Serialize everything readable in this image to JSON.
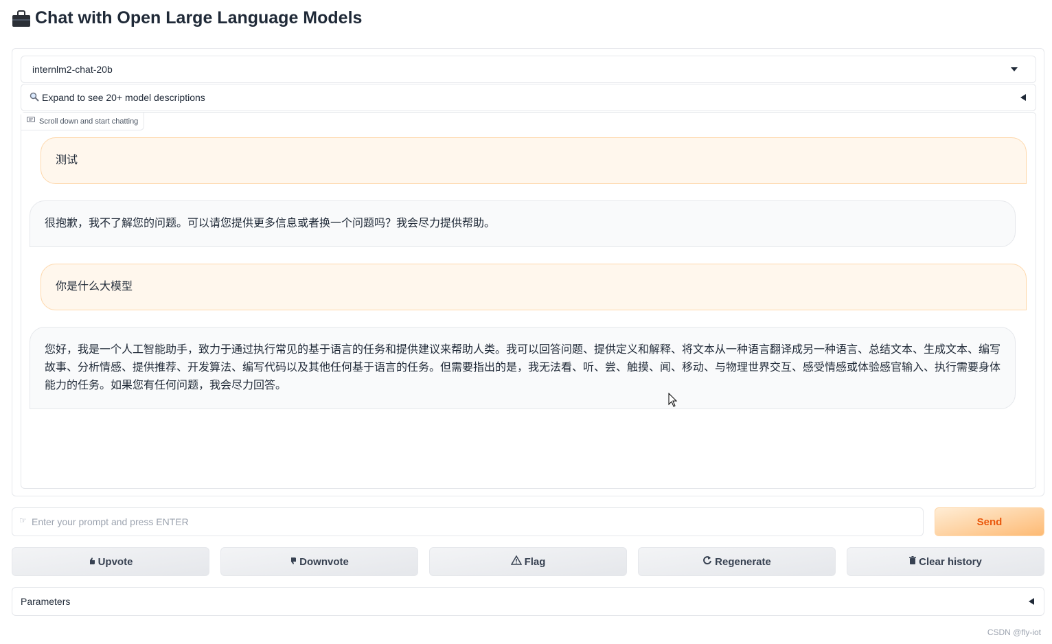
{
  "header": {
    "title": "Chat with Open Large Language Models"
  },
  "model_selector": {
    "value": "internlm2-chat-20b"
  },
  "model_descriptions": {
    "label": "Expand to see 20+ model descriptions"
  },
  "chatbot": {
    "label": "Scroll down and start chatting",
    "messages": [
      {
        "role": "user",
        "text": "测试"
      },
      {
        "role": "assistant",
        "text": "很抱歉，我不了解您的问题。可以请您提供更多信息或者换一个问题吗？我会尽力提供帮助。"
      },
      {
        "role": "user",
        "text": "你是什么大模型"
      },
      {
        "role": "assistant",
        "text": "您好，我是一个人工智能助手，致力于通过执行常见的基于语言的任务和提供建议来帮助人类。我可以回答问题、提供定义和解释、将文本从一种语言翻译成另一种语言、总结文本、生成文本、编写故事、分析情感、提供推荐、开发算法、编写代码以及其他任何基于语言的任务。但需要指出的是，我无法看、听、尝、触摸、闻、移动、与物理世界交互、感受情感或体验感官输入、执行需要身体能力的任务。如果您有任何问题，我会尽力回答。"
      }
    ]
  },
  "input": {
    "placeholder": "Enter your prompt and press ENTER",
    "send_label": "Send"
  },
  "actions": {
    "upvote": "Upvote",
    "downvote": "Downvote",
    "flag": "Flag",
    "regenerate": "Regenerate",
    "clear": "Clear history"
  },
  "parameters": {
    "label": "Parameters"
  },
  "watermark": "CSDN @fly-iot",
  "colors": {
    "accent": "#ea580c",
    "user_bubble": "#fff7ed",
    "bot_bubble": "#f9fafb"
  }
}
